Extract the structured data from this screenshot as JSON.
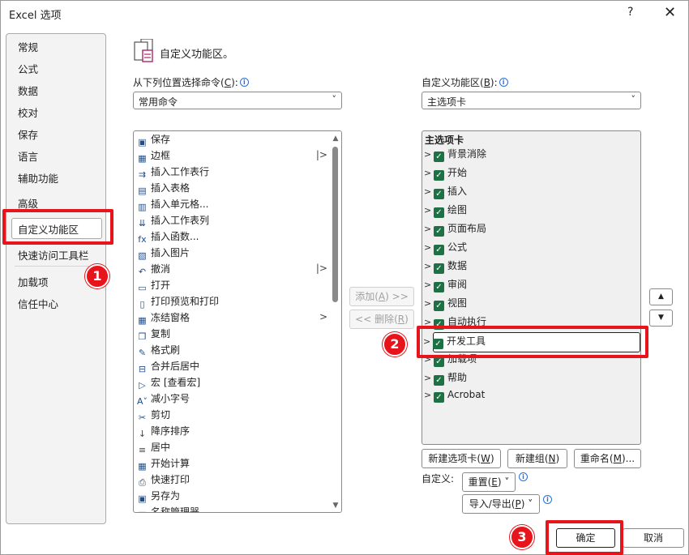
{
  "window": {
    "title": "Excel 选项",
    "help_glyph": "?",
    "close_glyph": "✕"
  },
  "sidebar": {
    "items": [
      {
        "label": "常规",
        "name": "sidebar-item-general"
      },
      {
        "label": "公式",
        "name": "sidebar-item-formulas"
      },
      {
        "label": "数据",
        "name": "sidebar-item-data"
      },
      {
        "label": "校对",
        "name": "sidebar-item-proofing"
      },
      {
        "label": "保存",
        "name": "sidebar-item-save"
      },
      {
        "label": "语言",
        "name": "sidebar-item-language"
      },
      {
        "label": "辅助功能",
        "name": "sidebar-item-accessibility"
      },
      {
        "label": "高级",
        "name": "sidebar-item-advanced"
      },
      {
        "label": "自定义功能区",
        "name": "sidebar-item-customize-ribbon"
      },
      {
        "label": "快速访问工具栏",
        "name": "sidebar-item-quick-access"
      },
      {
        "label": "加载项",
        "name": "sidebar-item-addins"
      },
      {
        "label": "信任中心",
        "name": "sidebar-item-trust-center"
      }
    ],
    "selected": "自定义功能区"
  },
  "header": {
    "title": "自定义功能区。"
  },
  "left": {
    "label": "从下列位置选择命令(",
    "label_key": "C",
    "label_end": "):",
    "dropdown_value": "常用命令",
    "commands": [
      {
        "label": "保存",
        "icon": "save-icon",
        "glyph": "▣",
        "sub": ""
      },
      {
        "label": "边框",
        "icon": "border-icon",
        "glyph": "▦",
        "sub": "|>"
      },
      {
        "label": "插入工作表行",
        "icon": "insert-row-icon",
        "glyph": "⇉",
        "sub": ""
      },
      {
        "label": "插入表格",
        "icon": "table-icon",
        "glyph": "▤",
        "sub": ""
      },
      {
        "label": "插入单元格...",
        "icon": "insert-cell-icon",
        "glyph": "▥",
        "sub": ""
      },
      {
        "label": "插入工作表列",
        "icon": "insert-column-icon",
        "glyph": "⇊",
        "sub": ""
      },
      {
        "label": "插入函数...",
        "icon": "function-icon",
        "glyph": "fx",
        "sub": ""
      },
      {
        "label": "插入图片",
        "icon": "picture-icon",
        "glyph": "▧",
        "sub": ""
      },
      {
        "label": "撤消",
        "icon": "undo-icon",
        "glyph": "↶",
        "sub": "|>"
      },
      {
        "label": "打开",
        "icon": "open-folder-icon",
        "glyph": "▭",
        "sub": ""
      },
      {
        "label": "打印预览和打印",
        "icon": "print-preview-icon",
        "glyph": "▯",
        "sub": ""
      },
      {
        "label": "冻结窗格",
        "icon": "freeze-panes-icon",
        "glyph": "▦",
        "sub": ">"
      },
      {
        "label": "复制",
        "icon": "copy-icon",
        "glyph": "❐",
        "sub": ""
      },
      {
        "label": "格式刷",
        "icon": "format-painter-icon",
        "glyph": "✎",
        "sub": ""
      },
      {
        "label": "合并后居中",
        "icon": "merge-center-icon",
        "glyph": "⊟",
        "sub": ""
      },
      {
        "label": "宏 [查看宏]",
        "icon": "macro-icon",
        "glyph": "▷",
        "sub": ""
      },
      {
        "label": "减小字号",
        "icon": "decrease-font-icon",
        "glyph": "A˅",
        "sub": ""
      },
      {
        "label": "剪切",
        "icon": "cut-icon",
        "glyph": "✂",
        "sub": ""
      },
      {
        "label": "降序排序",
        "icon": "sort-desc-icon",
        "glyph": "↓",
        "sub": ""
      },
      {
        "label": "居中",
        "icon": "align-center-icon",
        "glyph": "≡",
        "sub": ""
      },
      {
        "label": "开始计算",
        "icon": "calculator-icon",
        "glyph": "▦",
        "sub": ""
      },
      {
        "label": "快速打印",
        "icon": "quick-print-icon",
        "glyph": "⎙",
        "sub": ""
      },
      {
        "label": "另存为",
        "icon": "save-as-icon",
        "glyph": "▣",
        "sub": ""
      },
      {
        "label": "名称管理器",
        "icon": "name-manager-icon",
        "glyph": "▤",
        "sub": ""
      }
    ]
  },
  "middle": {
    "add_label": "添加(",
    "add_key": "A",
    "add_end": ") >>",
    "remove_label": "<< 删除(",
    "remove_key": "R",
    "remove_end": ")"
  },
  "right": {
    "label": "自定义功能区(",
    "label_key": "B",
    "label_end": "):",
    "dropdown_value": "主选项卡",
    "tree_header": "主选项卡",
    "tabs": [
      {
        "label": "背景消除",
        "checked": true
      },
      {
        "label": "开始",
        "checked": true
      },
      {
        "label": "插入",
        "checked": true
      },
      {
        "label": "绘图",
        "checked": true
      },
      {
        "label": "页面布局",
        "checked": true
      },
      {
        "label": "公式",
        "checked": true
      },
      {
        "label": "数据",
        "checked": true
      },
      {
        "label": "审阅",
        "checked": true
      },
      {
        "label": "视图",
        "checked": true
      },
      {
        "label": "自动执行",
        "checked": true
      },
      {
        "label": "开发工具",
        "checked": true
      },
      {
        "label": "加载项",
        "checked": true
      },
      {
        "label": "帮助",
        "checked": true
      },
      {
        "label": "Acrobat",
        "checked": true
      }
    ],
    "selected_tab": "开发工具",
    "new_tab_label": "新建选项卡(",
    "new_tab_key": "W",
    "new_tab_end": ")",
    "new_group_label": "新建组(",
    "new_group_key": "N",
    "new_group_end": ")",
    "rename_label": "重命名(",
    "rename_key": "M",
    "rename_end": ")...",
    "customize_label": "自定义:",
    "reset_label": "重置(",
    "reset_key": "E",
    "reset_end": ") ˅",
    "import_export_label": "导入/导出(",
    "import_export_key": "P",
    "import_export_end": ") ˅"
  },
  "footer": {
    "ok_label": "确定",
    "cancel_label": "取消"
  },
  "annotations": {
    "badge1": "1",
    "badge2": "2",
    "badge3": "3",
    "color": "#e8141b"
  }
}
